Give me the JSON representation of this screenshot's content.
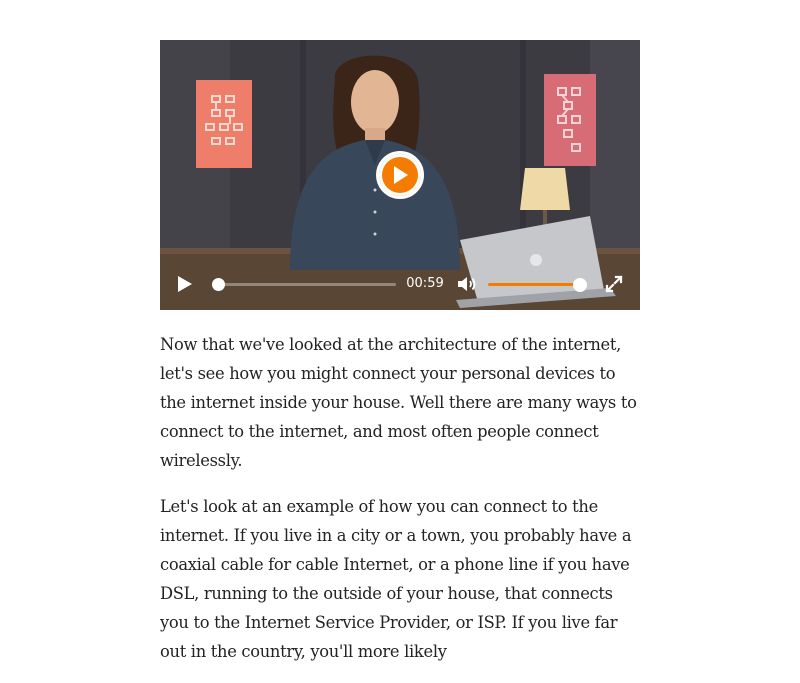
{
  "video": {
    "current_time": "00:59",
    "progress": 0.0,
    "volume": 1.0,
    "accent_color": "#f47c00",
    "icons": {
      "big_play": "play-circle-icon",
      "play": "play-icon",
      "volume": "volume-icon",
      "fullscreen": "fullscreen-icon"
    }
  },
  "transcript": {
    "paragraphs": [
      "Now that we've looked at the architecture of the internet, let's see how you might connect your personal devices to the internet inside your house. Well there are many ways to connect to the internet, and most often people connect wirelessly.",
      "Let's look at an example of how you can connect to the internet. If you live in a city or a town, you probably have a coaxial cable for cable Internet, or a phone line if you have DSL, running to the outside of your house, that connects you to the Internet Service Provider, or ISP. If you live far out in the country, you'll more likely"
    ]
  }
}
